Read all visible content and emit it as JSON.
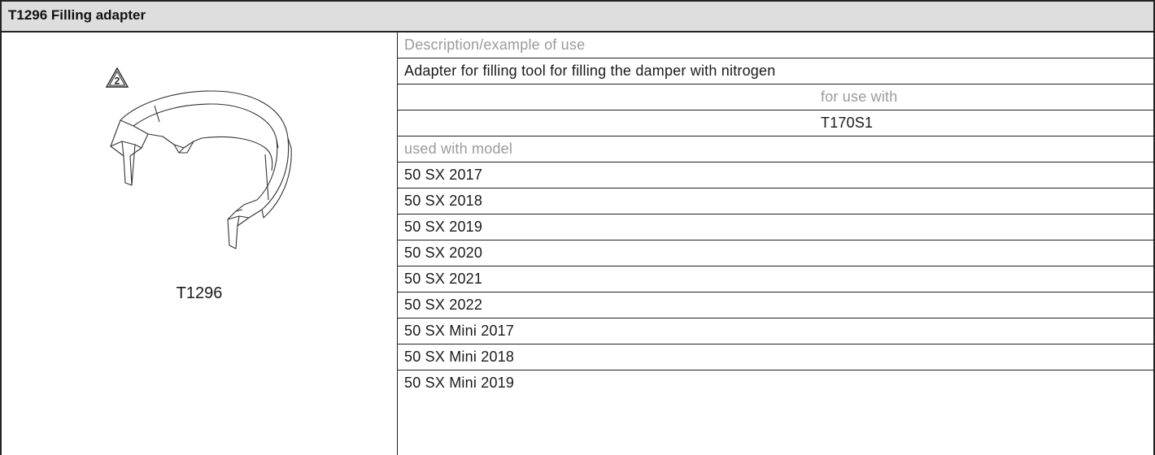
{
  "header": {
    "title": "T1296 Filling adapter"
  },
  "illustration": {
    "warning_number": "2",
    "icon": "filling-adapter-drawing",
    "tool_label": "T1296"
  },
  "details": {
    "description_label": "Description/example of use",
    "description_text": "Adapter for filling tool for filling the damper with nitrogen",
    "for_use_with_label": "for use with",
    "for_use_with_value": "T170S1",
    "used_with_model_label": "used with model",
    "models": [
      "50 SX 2017",
      "50 SX 2018",
      "50 SX 2019",
      "50 SX 2020",
      "50 SX 2021",
      "50 SX 2022",
      "50 SX Mini 2017",
      "50 SX Mini 2018",
      "50 SX Mini 2019"
    ]
  }
}
